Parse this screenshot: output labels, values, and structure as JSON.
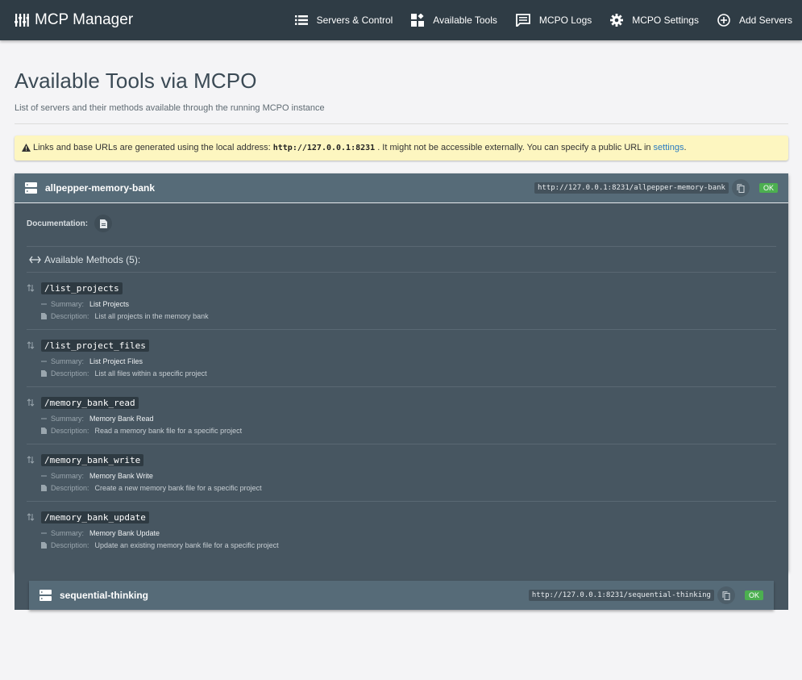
{
  "nav": {
    "brand": "MCP Manager",
    "items": [
      {
        "label": "Servers & Control",
        "icon": "list-icon"
      },
      {
        "label": "Available Tools",
        "icon": "widgets-icon"
      },
      {
        "label": "MCPO Logs",
        "icon": "message-icon"
      },
      {
        "label": "MCPO Settings",
        "icon": "gear-icon"
      },
      {
        "label": "Add Servers",
        "icon": "plus-circle-icon"
      }
    ]
  },
  "page": {
    "title": "Available Tools via MCPO",
    "subtitle": "List of servers and their methods available through the running MCPO instance"
  },
  "notice": {
    "text_before": "Links and base URLs are generated using the local address:",
    "address": "http://127.0.0.1:8231",
    "text_after": ". It might not be accessible externally. You can specify a public URL in",
    "link": "settings",
    "end": "."
  },
  "servers": [
    {
      "name": "allpepper-memory-bank",
      "url": "http://127.0.0.1:8231/allpepper-memory-bank",
      "status": "OK",
      "documentation_label": "Documentation:",
      "methods_title": "Available Methods (5):",
      "summary_label": "Summary:",
      "description_label": "Description:",
      "methods": [
        {
          "path": "/list_projects",
          "summary": "List Projects",
          "description": "List all projects in the memory bank"
        },
        {
          "path": "/list_project_files",
          "summary": "List Project Files",
          "description": "List all files within a specific project"
        },
        {
          "path": "/memory_bank_read",
          "summary": "Memory Bank Read",
          "description": "Read a memory bank file for a specific project"
        },
        {
          "path": "/memory_bank_write",
          "summary": "Memory Bank Write",
          "description": "Create a new memory bank file for a specific project"
        },
        {
          "path": "/memory_bank_update",
          "summary": "Memory Bank Update",
          "description": "Update an existing memory bank file for a specific project"
        }
      ]
    },
    {
      "name": "sequential-thinking",
      "url": "http://127.0.0.1:8231/sequential-thinking",
      "status": "OK"
    }
  ],
  "colors": {
    "navbar": "#2f3c45",
    "card_header": "#566b78",
    "card_body": "#475661",
    "notice_bg": "#fdf6c0",
    "ok": "#4caf50",
    "link": "#2a7bc0"
  }
}
